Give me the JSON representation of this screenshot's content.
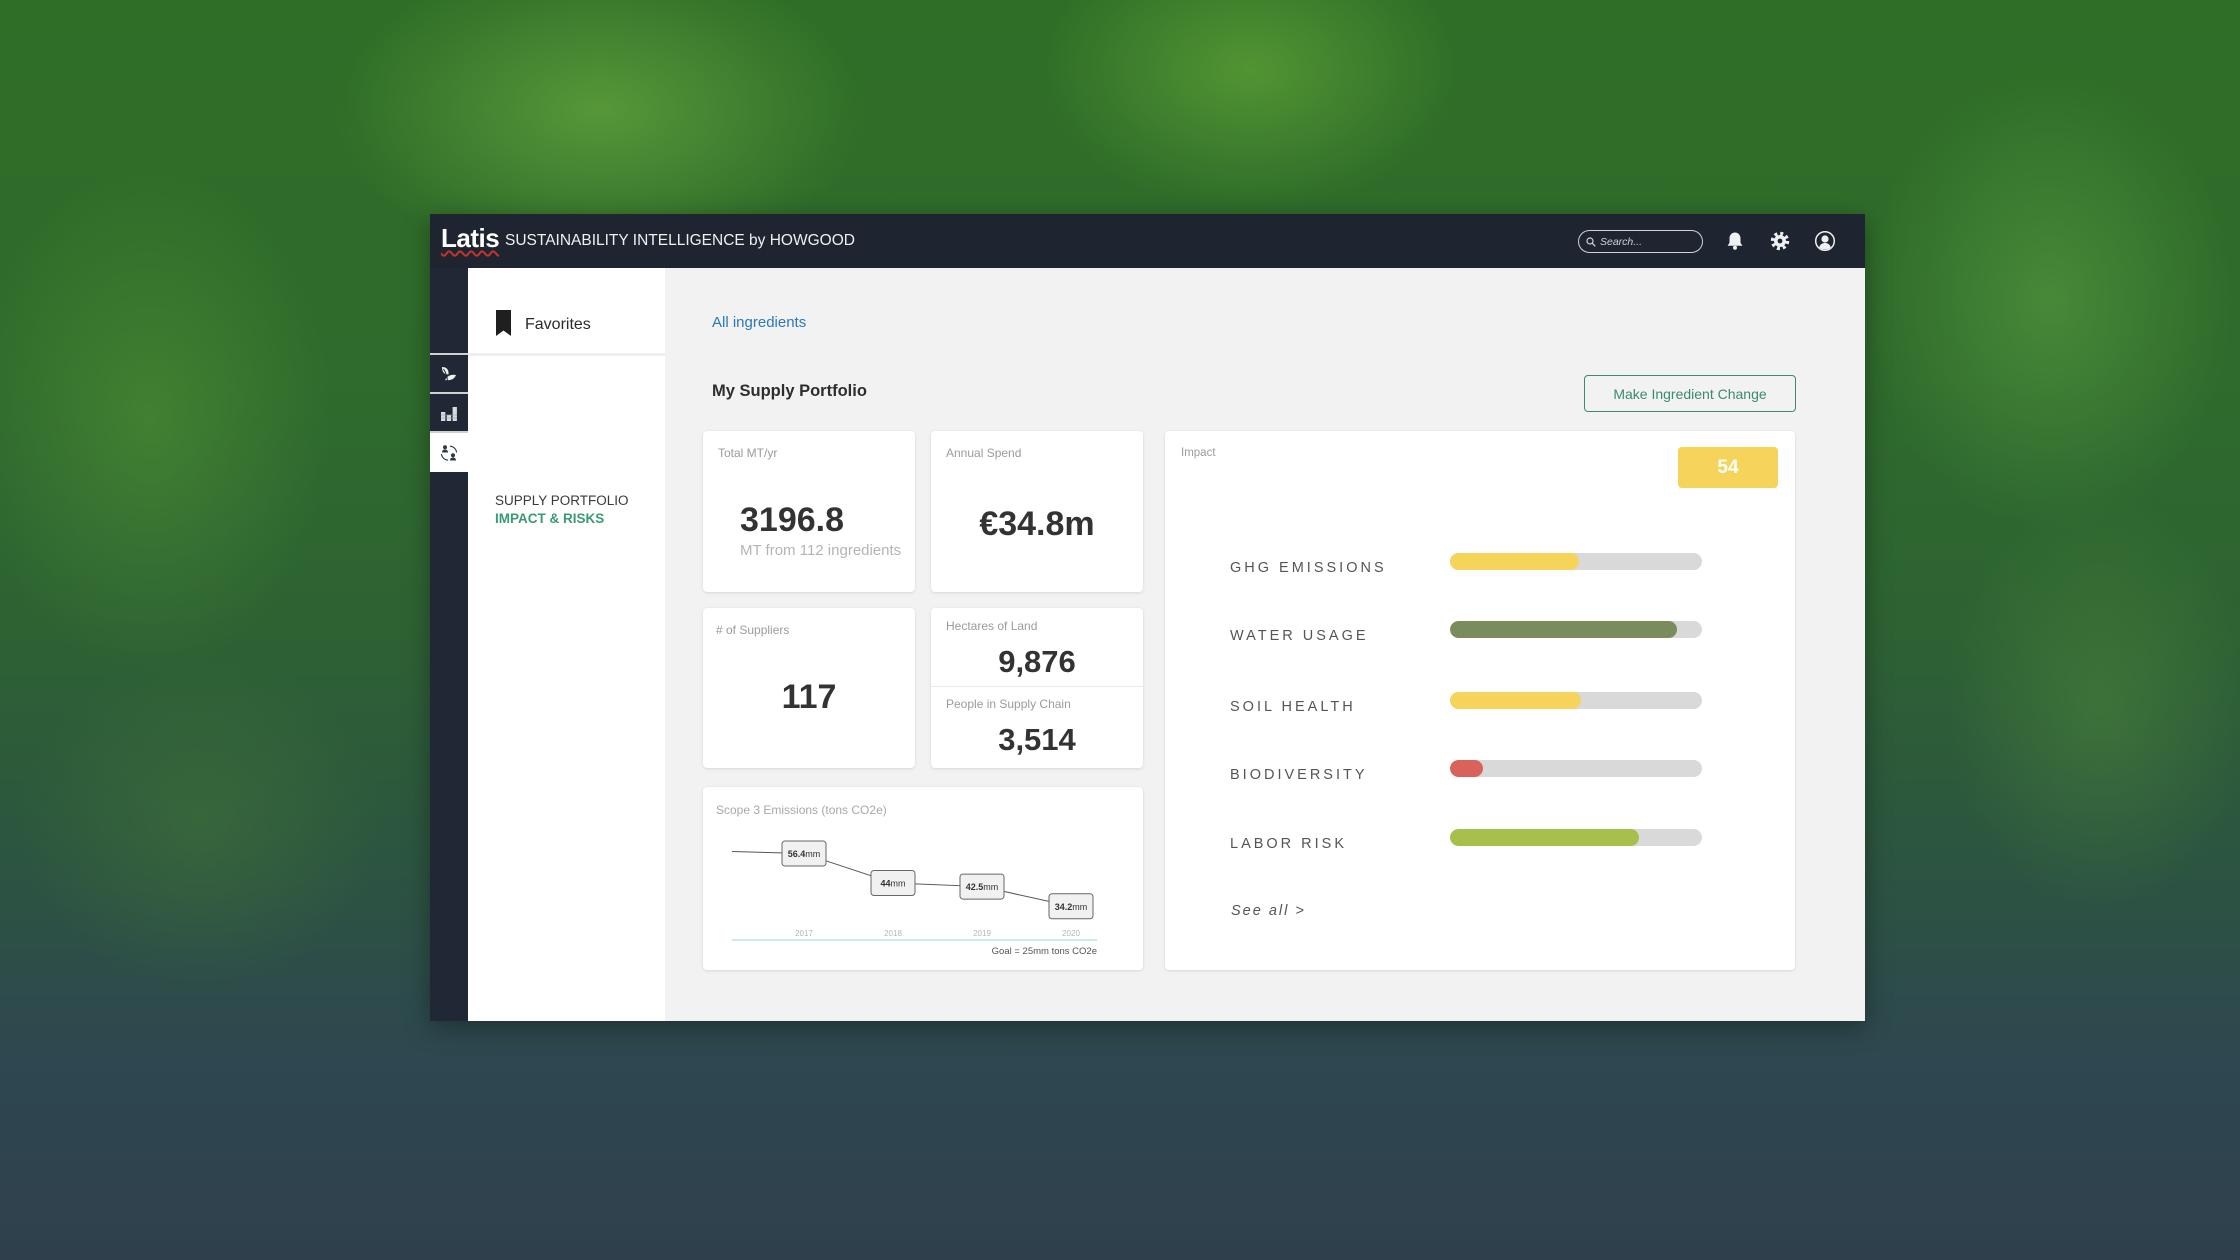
{
  "header": {
    "logo": "Latis",
    "subtitle": "SUSTAINABILITY INTELLIGENCE by HOWGOOD",
    "search_placeholder": "Search...",
    "icons": [
      "search-icon",
      "bell-icon",
      "gear-icon",
      "user-icon"
    ]
  },
  "rail": {
    "items": [
      {
        "icon": "leaf-icon",
        "active": false
      },
      {
        "icon": "bar-chart-icon",
        "active": false
      },
      {
        "icon": "people-sync-icon",
        "active": true
      }
    ]
  },
  "nav": {
    "favorites_label": "Favorites",
    "items": [
      {
        "label": "SUPPLY PORTFOLIO",
        "active": false
      },
      {
        "label": "IMPACT & RISKS",
        "active": true
      }
    ]
  },
  "main": {
    "breadcrumb": "All ingredients",
    "title": "My Supply Portfolio",
    "action_button": "Make Ingredient Change",
    "cards": {
      "total_mt": {
        "label": "Total MT/yr",
        "value": "3196.8",
        "sub": "MT from 112 ingredients"
      },
      "annual_spend": {
        "label": "Annual Spend",
        "value": "€34.8m"
      },
      "suppliers": {
        "label": "# of Suppliers",
        "value": "117"
      },
      "hectares": {
        "label": "Hectares of Land",
        "value": "9,876"
      },
      "people": {
        "label": "People in Supply Chain",
        "value": "3,514"
      }
    },
    "emissions": {
      "title": "Scope 3 Emissions (tons CO2e)",
      "goal": "Goal = 25mm tons CO2e"
    },
    "impact": {
      "label": "Impact",
      "score": "54",
      "see_all": "See all >",
      "metrics": [
        {
          "label": "GHG EMISSIONS",
          "value": 0.51,
          "color": "#f6d35a"
        },
        {
          "label": "WATER USAGE",
          "value": 0.9,
          "color": "#7a8b5c"
        },
        {
          "label": "SOIL HEALTH",
          "value": 0.52,
          "color": "#f6d35a"
        },
        {
          "label": "BIODIVERSITY",
          "value": 0.13,
          "color": "#d9625a"
        },
        {
          "label": "LABOR RISK",
          "value": 0.75,
          "color": "#a6c04b"
        }
      ]
    }
  },
  "colors": {
    "header_bg": "#1e2530",
    "accent_green": "#3c8a72",
    "link_blue": "#2a78b8",
    "score_yellow": "#f6d35a",
    "axis_teal": "#9ed6cc"
  },
  "chart_data": {
    "type": "line",
    "title": "Scope 3 Emissions (tons CO2e)",
    "categories": [
      "2017",
      "2018",
      "2019",
      "2020"
    ],
    "values": [
      56.4,
      44,
      42.5,
      34.2
    ],
    "unit": "mm",
    "xlabel": "",
    "ylabel": "",
    "ylim": [
      20,
      60
    ],
    "annotations": [
      "Goal = 25mm tons CO2e"
    ],
    "grid": false
  }
}
